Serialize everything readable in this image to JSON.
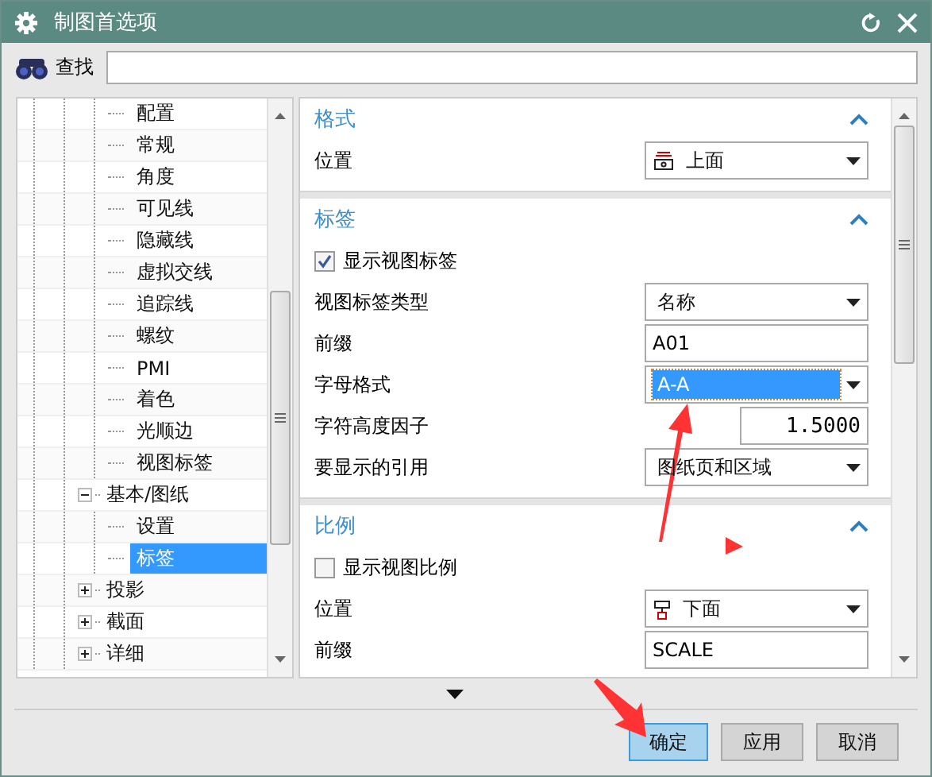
{
  "window": {
    "title": "制图首选项"
  },
  "search": {
    "label": "查找"
  },
  "tree": [
    {
      "children": [
        {
          "label": "配置",
          "selected": false
        },
        {
          "label": "常规",
          "selected": false
        },
        {
          "label": "角度",
          "selected": false
        },
        {
          "label": "可见线",
          "selected": false
        },
        {
          "label": "隐藏线",
          "selected": false
        },
        {
          "label": "虚拟交线",
          "selected": false
        },
        {
          "label": "追踪线",
          "selected": false
        },
        {
          "label": "螺纹",
          "selected": false
        },
        {
          "label": "PMI",
          "selected": false
        },
        {
          "label": "着色",
          "selected": false
        },
        {
          "label": "光顺边",
          "selected": false
        },
        {
          "label": "视图标签",
          "selected": false
        }
      ]
    },
    {
      "label": "基本/图纸",
      "selected": false,
      "expanded": true,
      "children": [
        {
          "label": "设置",
          "selected": false
        },
        {
          "label": "标签",
          "selected": true
        }
      ]
    },
    {
      "label": "投影",
      "selected": false,
      "expanded": false
    },
    {
      "label": "截面",
      "selected": false,
      "expanded": false
    },
    {
      "label": "详细",
      "selected": false,
      "expanded": false
    }
  ],
  "sections": [
    {
      "title": "格式",
      "expanded": true,
      "rows": [
        {
          "kind": "above",
          "label": "位置",
          "value": "上面"
        }
      ]
    },
    {
      "title": "标签",
      "expanded": true,
      "rows": [
        {
          "kind": "checkbox",
          "label": "显示视图标签",
          "checked": true
        },
        {
          "kind": "dropdown",
          "label": "视图标签类型",
          "value": "名称"
        },
        {
          "kind": "text",
          "label": "前缀",
          "value": "A01"
        },
        {
          "kind": "dropdown",
          "label": "字母格式",
          "value": "A-A",
          "highlighted": true
        },
        {
          "kind": "number",
          "label": "字符高度因子",
          "value": "1.5000"
        },
        {
          "kind": "dropdown",
          "label": "要显示的引用",
          "value": "图纸页和区域"
        }
      ]
    },
    {
      "title": "比例",
      "expanded": true,
      "rows": [
        {
          "kind": "checkbox",
          "label": "显示视图比例",
          "checked": false
        },
        {
          "kind": "below",
          "label": "位置",
          "value": "下面"
        },
        {
          "kind": "text",
          "label": "前缀",
          "value": "SCALE"
        }
      ]
    }
  ],
  "buttons": [
    {
      "label": "确定",
      "focused": true
    },
    {
      "label": "应用",
      "focused": false
    },
    {
      "label": "取消",
      "focused": false
    }
  ]
}
